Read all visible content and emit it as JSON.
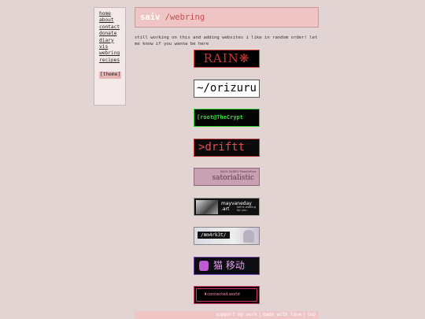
{
  "sidebar": {
    "items": [
      "home",
      "about",
      "contact",
      "donate",
      "diary",
      "vis",
      "webring",
      "recipes"
    ],
    "theme": "[theme]"
  },
  "header": {
    "name": "saiv",
    "path": " /webring"
  },
  "intro": "still working on this and adding websites i like in random order! let me know if you wanna be here",
  "buttons": {
    "rain": "RAIN❋",
    "orizuru": "~/orizuru",
    "crypt": "[root@TheCrypt ~]$_",
    "driftt": ">driftt",
    "sator_small": "Sat0r ZADEO Wanderlust",
    "sator": "satorialistic",
    "mayvane_main": "mayvaneday",
    "mayvane_art": ".art",
    "mayvane_sub": "we're waiting for you",
    "mm": "/mm4rk3t/",
    "mao": "猫 移动",
    "conn": "⬆connected.world"
  },
  "footer": {
    "support": "support my work",
    "love": "made with love",
    "top": "top"
  },
  "colors": {
    "background": "#e2d4d3",
    "header_bg": "#eec5c4",
    "path_red": "#c94c4c"
  }
}
